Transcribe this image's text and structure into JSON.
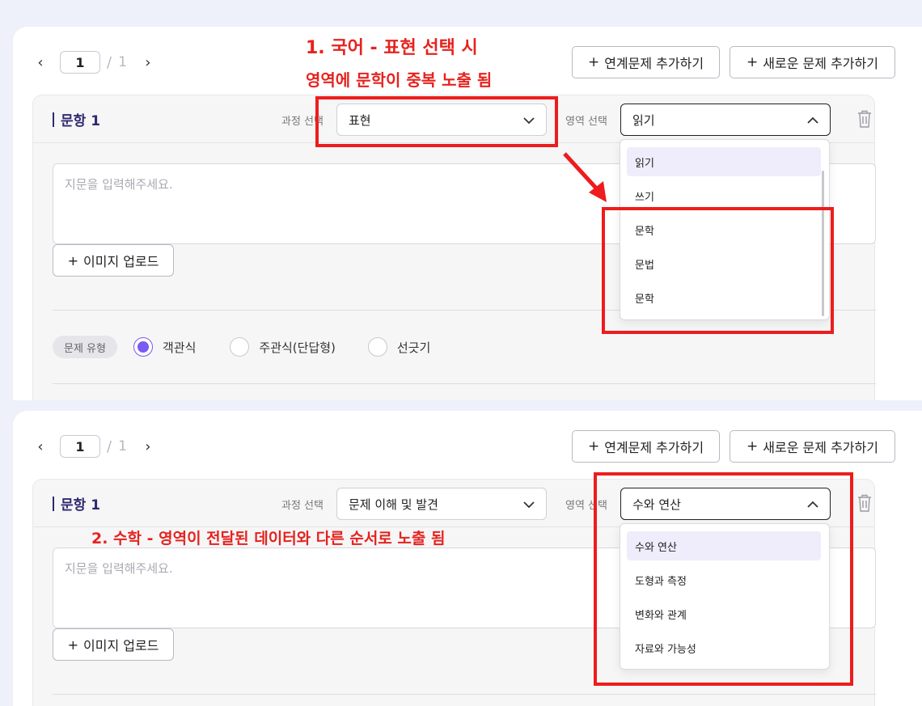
{
  "pager": {
    "prev": "‹",
    "current": "1",
    "separator": "/",
    "total": "1",
    "next": "›"
  },
  "buttons": {
    "add_linked": "연계문제 추가하기",
    "add_new": "새로운 문제 추가하기",
    "plus": "+"
  },
  "question_title": "문항 1",
  "labels": {
    "course": "과정 선택",
    "area": "영역 선택",
    "type": "문제 유형"
  },
  "passage_placeholder": "지문을 입력해주세요.",
  "upload_label": "이미지 업로드",
  "question_types": [
    "객관식",
    "주관식(단답형)",
    "선긋기"
  ],
  "selected_type_index": 0,
  "panel1": {
    "course_value": "표현",
    "area_value": "읽기",
    "area_options": [
      "읽기",
      "쓰기",
      "문학",
      "문법",
      "문학"
    ],
    "active_option_index": 0
  },
  "panel2": {
    "course_value": "문제 이해 및 발견",
    "area_value": "수와 연산",
    "area_options": [
      "수와 연산",
      "도형과 측정",
      "변화와 관계",
      "자료와 가능성"
    ],
    "active_option_index": 0
  },
  "annotations": {
    "a1_line1": "1. 국어 - 표현 선택 시",
    "a1_line2": "영역에 문학이 중복 노출 됨",
    "a2": "2. 수학 - 영역이 전달된 데이터와 다른 순서로 노출 됨"
  },
  "colors": {
    "accent": "#7a5af0",
    "annotation_red": "#ee1c1c",
    "title_navy": "#2e2a6e"
  },
  "icons": [
    "chevron-left-icon",
    "chevron-right-icon",
    "plus-icon",
    "chevron-down-icon",
    "chevron-up-icon",
    "trash-icon"
  ]
}
